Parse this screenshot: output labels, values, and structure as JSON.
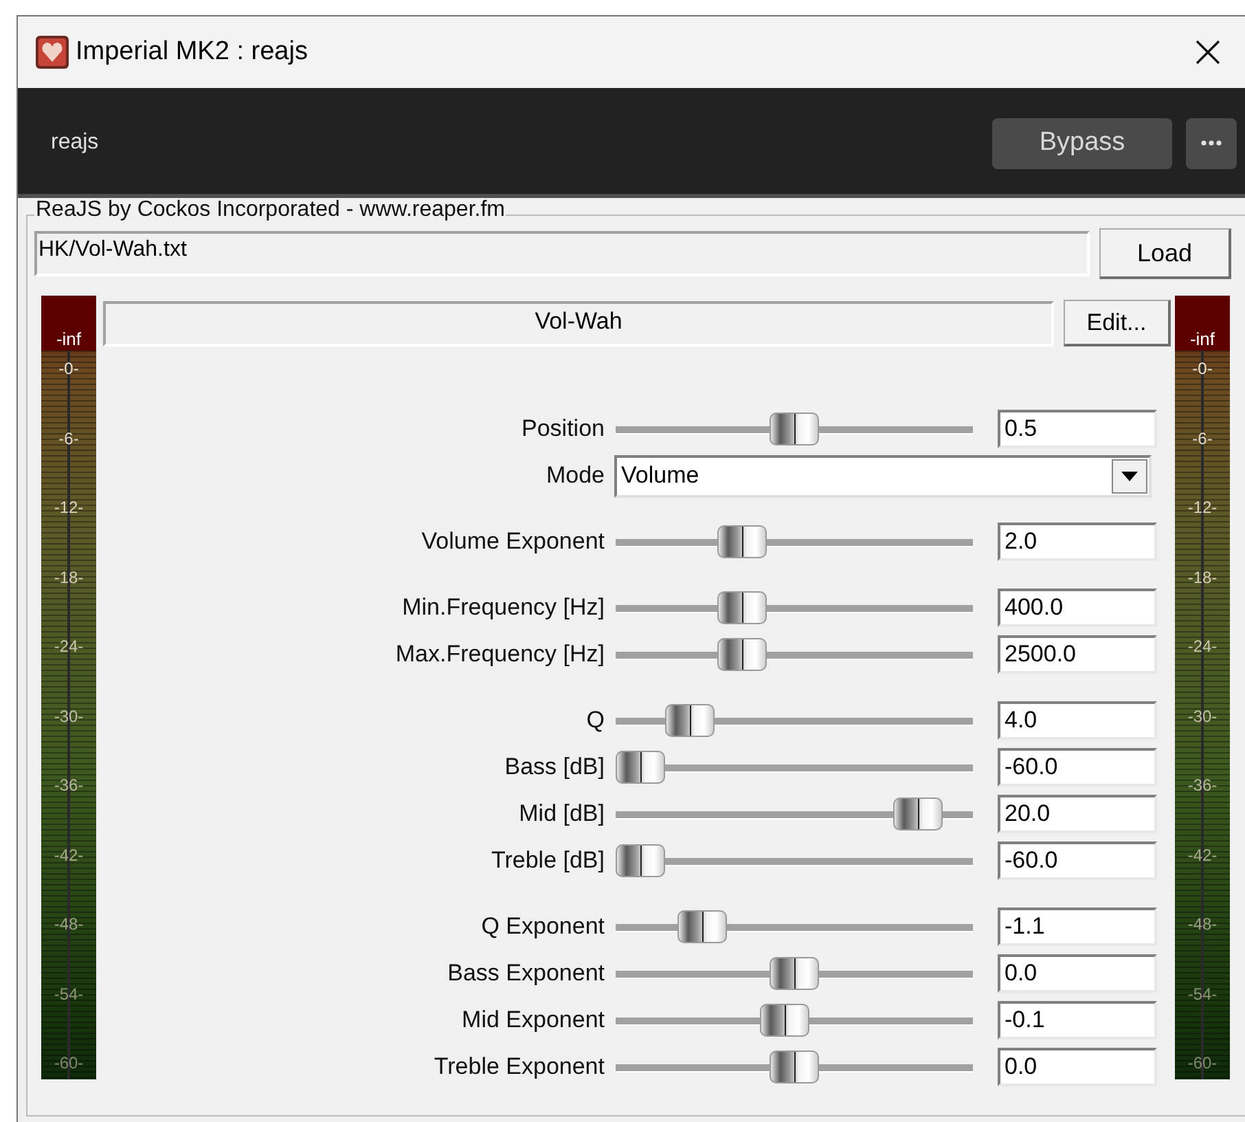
{
  "window": {
    "title": "Imperial MK2 : reajs"
  },
  "header": {
    "label": "reajs",
    "bypass_button": "Bypass"
  },
  "plugin": {
    "group_title": "ReaJS by Cockos Incorporated - www.reaper.fm",
    "file_path": "HK/Vol-Wah.txt",
    "load_button": "Load",
    "effect_name": "Vol-Wah",
    "edit_button": "Edit..."
  },
  "meters": [
    {
      "peak": "-inf",
      "scale": [
        "-0-",
        "-6-",
        "-12-",
        "-18-",
        "-24-",
        "-30-",
        "-36-",
        "-42-",
        "-48-",
        "-54-",
        "-60-"
      ]
    },
    {
      "peak": "-inf",
      "scale": [
        "-0-",
        "-6-",
        "-12-",
        "-18-",
        "-24-",
        "-30-",
        "-36-",
        "-42-",
        "-48-",
        "-54-",
        "-60-"
      ]
    }
  ],
  "parameter_groups": [
    {
      "parameters": [
        {
          "kind": "slider",
          "label": "Position",
          "value": "0.5"
        },
        {
          "kind": "dropdown",
          "label": "Mode",
          "value": "Volume"
        }
      ]
    },
    {
      "parameters": [
        {
          "kind": "slider",
          "label": "Volume Exponent",
          "value": "2.0"
        }
      ]
    },
    {
      "parameters": [
        {
          "kind": "slider",
          "label": "Min.Frequency [Hz]",
          "value": "400.0"
        },
        {
          "kind": "slider",
          "label": "Max.Frequency [Hz]",
          "value": "2500.0"
        }
      ]
    },
    {
      "parameters": [
        {
          "kind": "slider",
          "label": "Q",
          "value": "4.0"
        },
        {
          "kind": "slider",
          "label": "Bass [dB]",
          "value": "-60.0"
        },
        {
          "kind": "slider",
          "label": "Mid [dB]",
          "value": "20.0"
        },
        {
          "kind": "slider",
          "label": "Treble [dB]",
          "value": "-60.0"
        }
      ]
    },
    {
      "parameters": [
        {
          "kind": "slider",
          "label": "Q Exponent",
          "value": "-1.1"
        },
        {
          "kind": "slider",
          "label": "Bass Exponent",
          "value": "0.0"
        },
        {
          "kind": "slider",
          "label": "Mid Exponent",
          "value": "-0.1"
        },
        {
          "kind": "slider",
          "label": "Treble Exponent",
          "value": "0.0"
        }
      ]
    }
  ]
}
